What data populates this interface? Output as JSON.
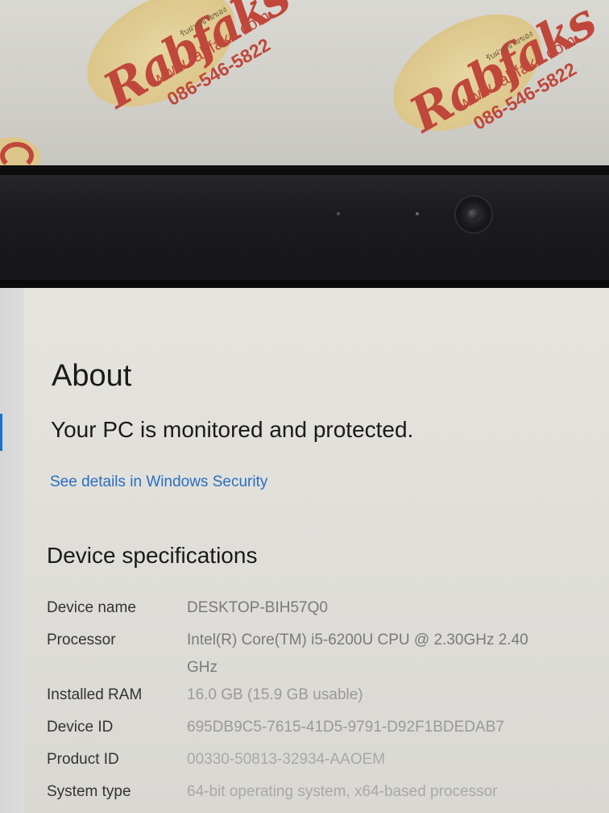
{
  "watermark": {
    "logo_text": "Rabfaks",
    "thai_text": "รับฝากขายของ",
    "url": "www.rabfaks.com",
    "phone": "086-546-5822"
  },
  "page": {
    "title": "About",
    "protection_status": "Your PC is monitored and protected.",
    "security_link": "See details in Windows Security",
    "section_title": "Device specifications"
  },
  "specs": [
    {
      "label": "Device name",
      "value": "DESKTOP-BIH57Q0"
    },
    {
      "label": "Processor",
      "value": "Intel(R) Core(TM) i5-6200U CPU @ 2.30GHz   2.40",
      "value_cont": "GHz"
    },
    {
      "label": "Installed RAM",
      "value": "16.0 GB (15.9 GB usable)"
    },
    {
      "label": "Device ID",
      "value": "695DB9C5-7615-41D5-9791-D92F1BDEDAB7"
    },
    {
      "label": "Product ID",
      "value": "00330-50813-32934-AAOEM"
    },
    {
      "label": "System type",
      "value": "64-bit operating system, x64-based processor"
    }
  ],
  "colors": {
    "link": "#2a6fc0",
    "accent": "#1f6fc2",
    "watermark_red": "#c0473b"
  }
}
